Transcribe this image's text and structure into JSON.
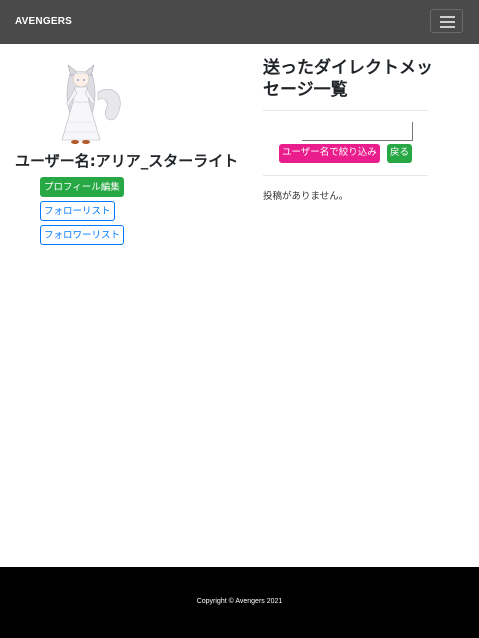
{
  "navbar": {
    "brand": "AVENGERS",
    "toggler_icon": "hamburger-menu-icon"
  },
  "profile": {
    "avatar_icon": "avatar-illustration",
    "username": "ユーザー名:アリア_スターライト",
    "edit_button": "プロフィール編集",
    "follow_button": "フォローリスト",
    "follower_button": "フォロワーリスト"
  },
  "messages": {
    "title": "送ったダイレクトメッセージ一覧",
    "search_value": "",
    "filter_button": "ユーザー名で絞り込み",
    "back_button": "戻る",
    "empty": "投稿がありません。"
  },
  "footer": {
    "copyright": "Copyright © Avengers 2021"
  },
  "colors": {
    "navbar": "#4a4a4a",
    "success": "#28a745",
    "primary": "#007bff",
    "pink": "#e91e8c",
    "footer": "#000000"
  }
}
